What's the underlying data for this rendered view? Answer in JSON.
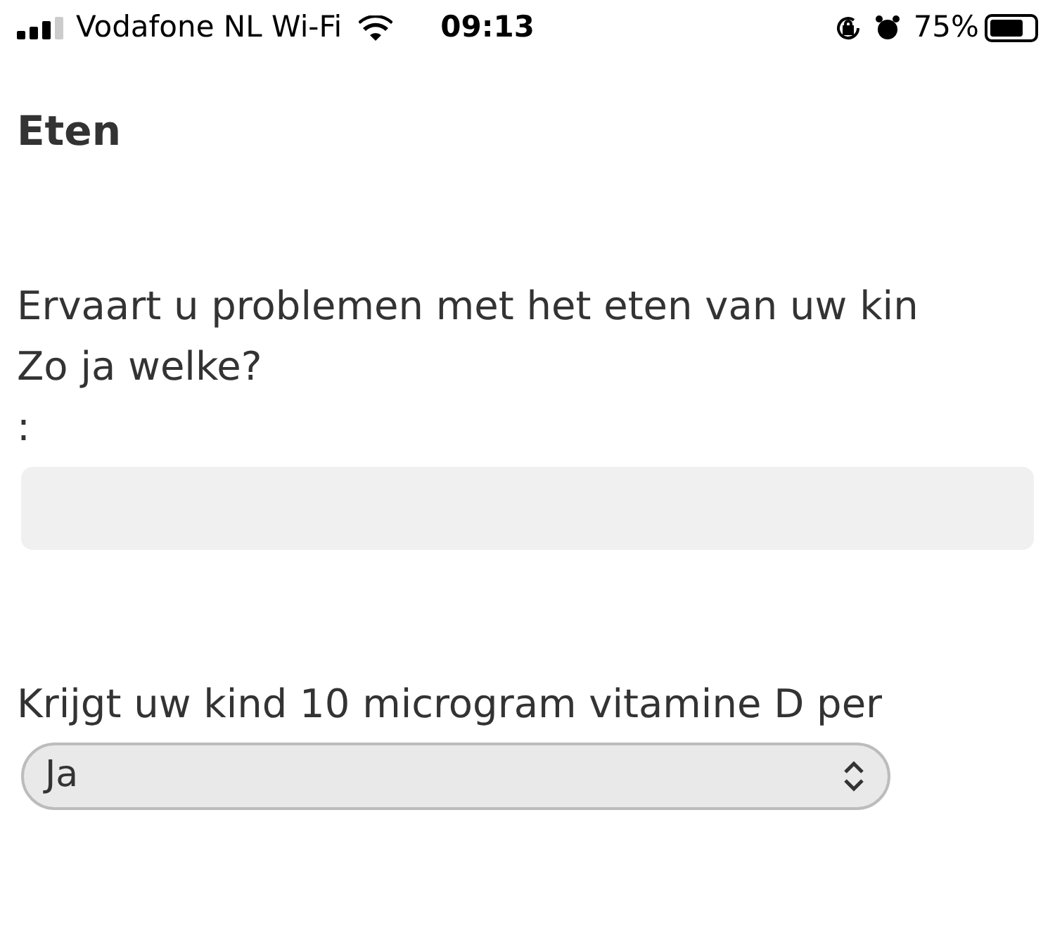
{
  "status_bar": {
    "carrier": "Vodafone NL Wi-Fi",
    "time": "09:13",
    "battery": "75%"
  },
  "title": "Eten",
  "questions": [
    {
      "kind": "text",
      "label_lines": [
        "Ervaart u problemen met het eten van uw kin",
        "Zo ja welke?",
        ":"
      ]
    },
    {
      "kind": "select",
      "label_lines": [
        "Krijgt uw kind 10 microgram vitamine D per"
      ],
      "value": "Ja"
    }
  ]
}
